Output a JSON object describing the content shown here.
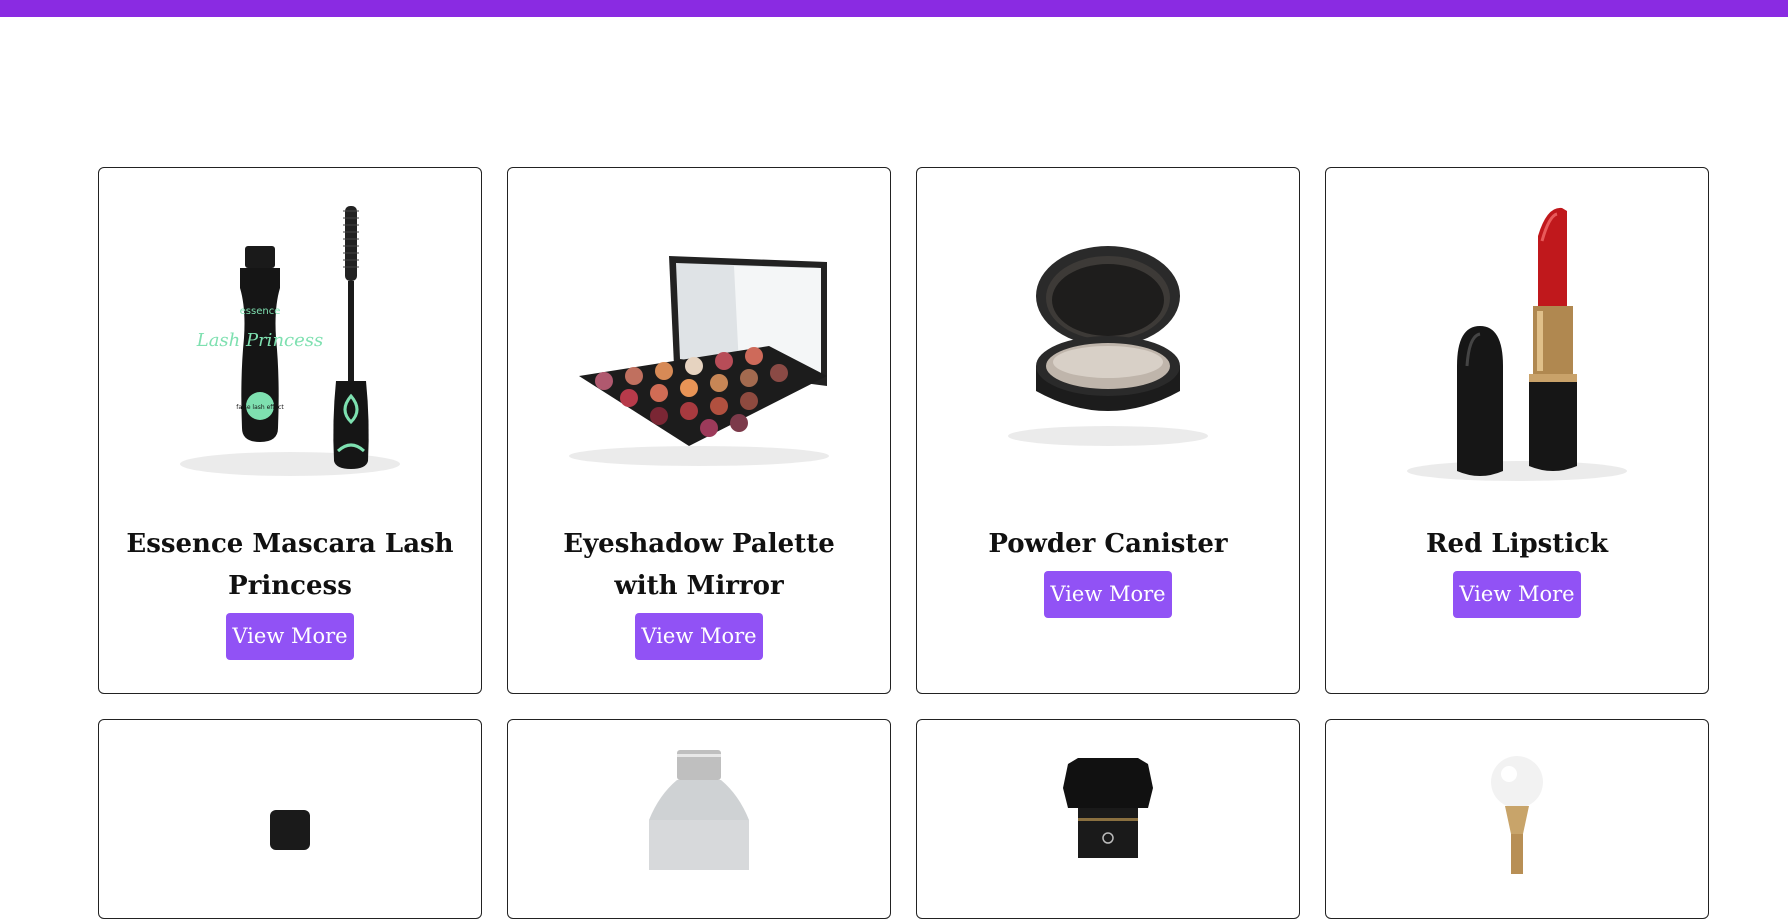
{
  "colors": {
    "top_bar": "#8a2be2",
    "button_bg": "#9152f5",
    "button_text": "#ffffff"
  },
  "products": [
    {
      "name": "Essence Mascara Lash Princess",
      "button": "View More",
      "image": "mascara-image",
      "brand_text": "essence",
      "product_text": "Lash Princess",
      "badge_text": "false lash effect"
    },
    {
      "name": "Eyeshadow Palette with Mirror",
      "button": "View More",
      "image": "eyeshadow-palette-image"
    },
    {
      "name": "Powder Canister",
      "button": "View More",
      "image": "powder-canister-image"
    },
    {
      "name": "Red Lipstick",
      "button": "View More",
      "image": "red-lipstick-image"
    },
    {
      "name": "",
      "button": "",
      "image": "bottle-image"
    },
    {
      "name": "",
      "button": "",
      "image": "silver-bottle-image"
    },
    {
      "name": "",
      "button": "",
      "image": "black-perfume-image"
    },
    {
      "name": "",
      "button": "",
      "image": "pearl-cap-perfume-image"
    }
  ]
}
